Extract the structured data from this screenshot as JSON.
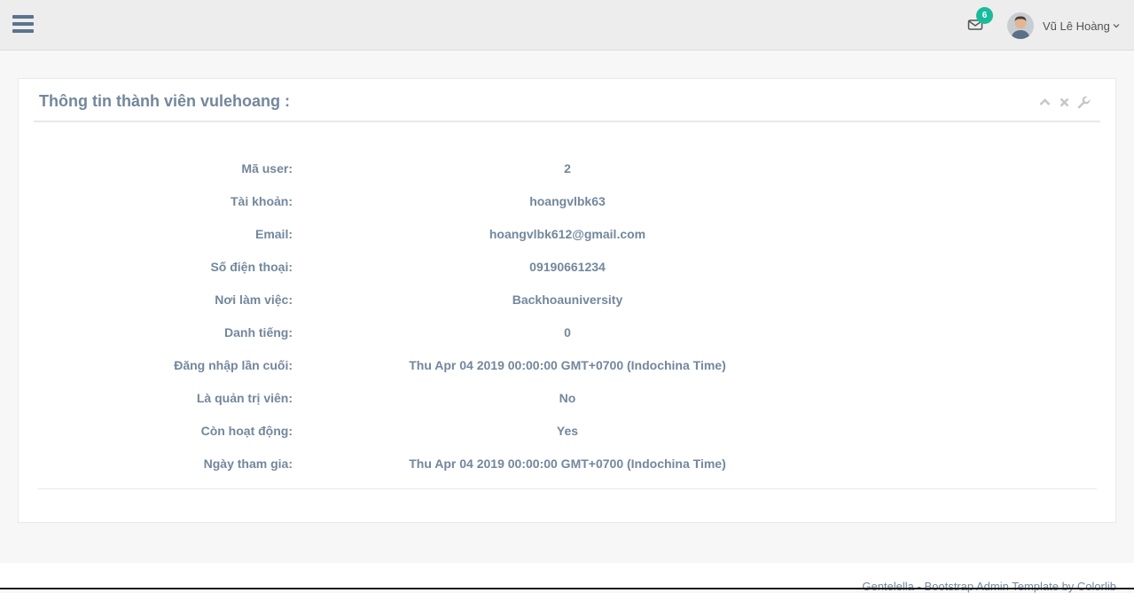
{
  "header": {
    "notifications_count": "6",
    "user_name": "Vũ Lê Hoàng"
  },
  "panel": {
    "title": "Thông tin thành viên vulehoang :",
    "rows": [
      {
        "label": "Mã user:",
        "value": "2"
      },
      {
        "label": "Tài khoản:",
        "value": "hoangvlbk63"
      },
      {
        "label": "Email:",
        "value": "hoangvlbk612@gmail.com"
      },
      {
        "label": "Số điện thoại:",
        "value": "09190661234"
      },
      {
        "label": "Nơi làm việc:",
        "value": "Backhoauniversity"
      },
      {
        "label": "Danh tiếng:",
        "value": "0"
      },
      {
        "label": "Đăng nhập lần cuối:",
        "value": "Thu Apr 04 2019 00:00:00 GMT+0700 (Indochina Time)"
      },
      {
        "label": "Là quản trị viên:",
        "value": "No"
      },
      {
        "label": "Còn hoạt động:",
        "value": "Yes"
      },
      {
        "label": "Ngày tham gia:",
        "value": "Thu Apr 04 2019 00:00:00 GMT+0700 (Indochina Time)"
      }
    ]
  },
  "footer": {
    "text": "Gentelella - Bootstrap Admin Template by Colorlib"
  },
  "colors": {
    "accent": "#1abb9c",
    "text": "#73879c",
    "nav_icon": "#5a738e"
  },
  "icons": [
    "hamburger-icon",
    "envelope-icon",
    "chevron-down-icon",
    "chevron-up-icon",
    "close-icon",
    "wrench-icon"
  ]
}
